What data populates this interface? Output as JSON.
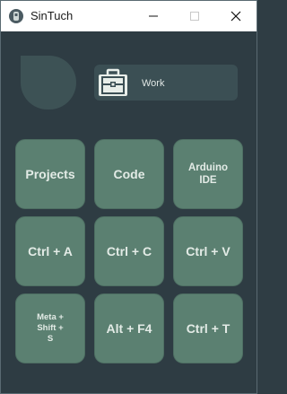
{
  "window": {
    "title": "SinTuch"
  },
  "profile": {
    "label": "Work",
    "icon": "briefcase-icon"
  },
  "buttons": [
    {
      "label": "Projects",
      "name": "projects-button",
      "size": "lg"
    },
    {
      "label": "Code",
      "name": "code-button",
      "size": "lg"
    },
    {
      "label": "Arduino\nIDE",
      "name": "arduino-ide-button",
      "size": "md"
    },
    {
      "label": "Ctrl + A",
      "name": "ctrl-a-button",
      "size": "lg"
    },
    {
      "label": "Ctrl + C",
      "name": "ctrl-c-button",
      "size": "lg"
    },
    {
      "label": "Ctrl + V",
      "name": "ctrl-v-button",
      "size": "lg"
    },
    {
      "label": "Meta +\nShift +\nS",
      "name": "meta-shift-s-button",
      "size": "sm"
    },
    {
      "label": "Alt + F4",
      "name": "alt-f4-button",
      "size": "lg"
    },
    {
      "label": "Ctrl + T",
      "name": "ctrl-t-button",
      "size": "lg"
    }
  ],
  "colors": {
    "background": "#2f3d44",
    "button": "#5b8071",
    "button_text": "#e3ebe6",
    "profile_bg": "#3b4f54",
    "avatar": "#3d5255"
  }
}
